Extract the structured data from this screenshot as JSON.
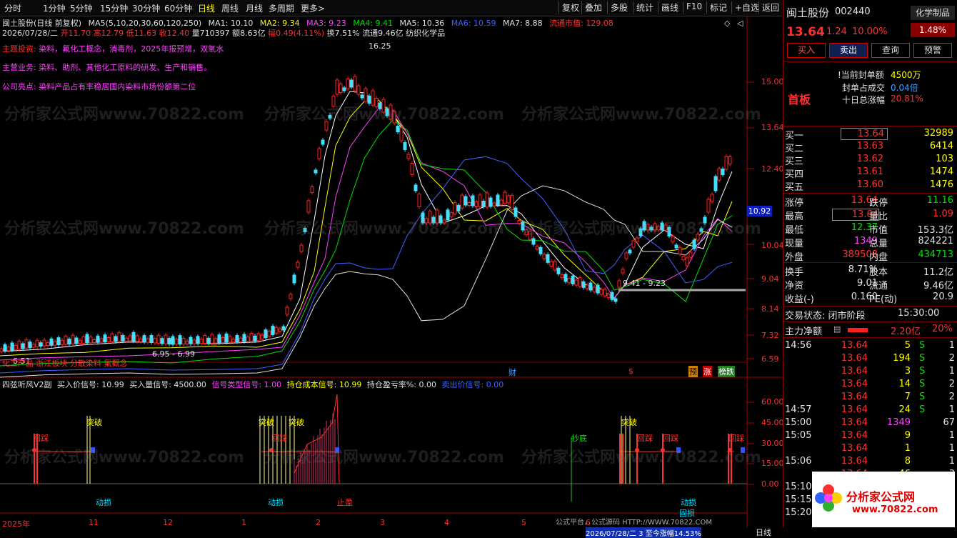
{
  "toolbar": {
    "periods": [
      "分时",
      "1分钟",
      "5分钟",
      "15分钟",
      "30分钟",
      "60分钟",
      "日线",
      "周线",
      "月线",
      "多周期",
      "更多>"
    ],
    "active_period": "日线",
    "buttons": [
      "复权",
      "叠加",
      "多股",
      "统计",
      "画线",
      "F10",
      "标记",
      "+自选",
      "返回"
    ]
  },
  "chart": {
    "title": "闽土股份(日线 前复权)",
    "ma_legend": {
      "params": "MA5(5,10,20,30,60,120,250)",
      "ma1": "MA1: 10.10",
      "ma2": "MA2: 9.34",
      "ma3": "MA3: 9.23",
      "ma4": "MA4: 9.41",
      "ma5": "MA5: 10.36",
      "ma6": "MA6: 10.59",
      "ma7": "MA7: 8.88",
      "float_cap": "流通市值: 129.08"
    },
    "bar_info": {
      "date": "2026/07/28/二",
      "open": "开11.70",
      "high": "高12.79",
      "low": "低11.63",
      "close": "收12.40",
      "volume": "量710397",
      "amount": "额8.63亿",
      "range": "幅0.49(4.11%)",
      "turnover": "换7.51%",
      "float": "流通9.46亿",
      "sector": "纺织化学品"
    },
    "notes": {
      "theme_label": "主题投资:",
      "theme": "染料，氟化工概念，消毒剂，2025年报预增，双氧水",
      "business_label": "主营业务:",
      "business": "染料、助剂、其他化工原料的研发、生产和销售。",
      "highlight_label": "公司亮点:",
      "highlight": "染料产品占有率稳居国内染料市场份额第二位"
    },
    "price_axis": [
      "15.00",
      "13.64",
      "12.40",
      "10.04",
      "9.04",
      "8.14",
      "7.32",
      "6.59"
    ],
    "current_price_tag": "10.92",
    "annotations": {
      "peak": "16.25",
      "low_range": "6.95 - 6.99",
      "mid_range": "9.41 - 9.23",
      "left_low": "6.51",
      "sector_tag": "化工产品 浙江板块 分散染料 氟概念",
      "fin_marker": "财",
      "dollar_marker": "$",
      "tag_yu": "预",
      "tag_zhang": "涨",
      "tag_bang": "榜跌"
    }
  },
  "indicator": {
    "name": "四弦听风V2副",
    "buy_price": "买入价信号: 10.99",
    "buy_qty": "买入量信号: 4500.00",
    "type": "信号类型信号: 1.00",
    "hold_cost": "持仓成本信号: 10.99",
    "hold_pl": "持仓盈亏率%: 0.00",
    "sell_price": "卖出价信号: 0.00",
    "axis": [
      "60.00",
      "45.00",
      "30.00",
      "15.00",
      "0.00"
    ],
    "labels": {
      "tupo": "突破",
      "hui_cai": "回踩",
      "dong_sun": "动损",
      "zhi_ying": "止盈",
      "chao_di": "抄底",
      "gu_sun": "固损"
    },
    "time_axis": [
      "2025年",
      "11",
      "12",
      "1",
      "2",
      "3",
      "4",
      "5",
      "6",
      "2026/07/28/二 3 至今涨幅14.53%",
      "日线"
    ],
    "footer": "公式平台，公式源码 HTTP://WWW.70822.COM"
  },
  "panel": {
    "stock_name": "闽土股份",
    "stock_code": "002440",
    "industry": "化学制品",
    "price": "13.64",
    "change": "1.24",
    "pct": "10.00%",
    "industry_pct": "1.48%",
    "actions": [
      "买入",
      "卖出",
      "查询",
      "预警"
    ],
    "board_label": "首板",
    "seal": [
      {
        "label": "!当前封单额",
        "value": "4500万"
      },
      {
        "label": "封单占成交",
        "value": "0.04倍"
      },
      {
        "label": "十日总涨幅",
        "value": "20.81%"
      }
    ],
    "sells": [
      {
        "label": "买一",
        "price": "13.64",
        "vol": "32989"
      },
      {
        "label": "买二",
        "price": "13.63",
        "vol": "6414"
      },
      {
        "label": "买三",
        "price": "13.62",
        "vol": "103"
      },
      {
        "label": "买四",
        "price": "13.61",
        "vol": "1474"
      },
      {
        "label": "买五",
        "price": "13.60",
        "vol": "1476"
      }
    ],
    "stats": [
      {
        "l1": "涨停",
        "v1": "13.64",
        "l2": "跌停",
        "v2": "11.16"
      },
      {
        "l1": "最高",
        "v1": "13.64",
        "l2": "量比",
        "v2": "1.09"
      },
      {
        "l1": "最低",
        "v1": "12.37",
        "l2": "市值",
        "v2": "153.3亿"
      },
      {
        "l1": "现量",
        "v1": "1349",
        "l2": "总量",
        "v2": "824221"
      },
      {
        "l1": "外盘",
        "v1": "389508",
        "l2": "内盘",
        "v2": "434713"
      }
    ],
    "fin": [
      {
        "l1": "换手",
        "v1": "8.71%",
        "l2": "股本",
        "v2": "11.2亿"
      },
      {
        "l1": "净资",
        "v1": "9.01",
        "l2": "流通",
        "v2": "9.46亿"
      },
      {
        "l1": "收益(-)",
        "v1": "0.160",
        "l2": "PE(动)",
        "v2": "20.9"
      }
    ],
    "trade_status": "交易状态: 闭市阶段",
    "trade_time": "15:30:00",
    "main_flow_label": "主力净额",
    "main_flow": "2.20亿",
    "main_flow_pct": "20%",
    "ticks": [
      {
        "t": "14:56",
        "p": "13.64",
        "v": "5",
        "s": "S",
        "n": "1"
      },
      {
        "t": "",
        "p": "13.64",
        "v": "194",
        "s": "S",
        "n": "2"
      },
      {
        "t": "",
        "p": "13.64",
        "v": "3",
        "s": "S",
        "n": "1"
      },
      {
        "t": "",
        "p": "13.64",
        "v": "14",
        "s": "S",
        "n": "2"
      },
      {
        "t": "",
        "p": "13.64",
        "v": "7",
        "s": "S",
        "n": "2"
      },
      {
        "t": "14:57",
        "p": "13.64",
        "v": "24",
        "s": "S",
        "n": "1"
      },
      {
        "t": "15:00",
        "p": "13.64",
        "v": "1349",
        "s": "",
        "n": "67"
      },
      {
        "t": "15:05",
        "p": "13.64",
        "v": "9",
        "s": "",
        "n": "1"
      },
      {
        "t": "",
        "p": "13.64",
        "v": "1",
        "s": "",
        "n": "1"
      },
      {
        "t": "15:06",
        "p": "13.64",
        "v": "8",
        "s": "",
        "n": "1"
      },
      {
        "t": "",
        "p": "13.64",
        "v": "46",
        "s": "",
        "n": "3"
      },
      {
        "t": "15:10",
        "p": "13.64",
        "v": "",
        "s": "",
        "n": ""
      },
      {
        "t": "15:15",
        "p": "",
        "v": "",
        "s": "",
        "n": ""
      },
      {
        "t": "15:20",
        "p": "",
        "v": "",
        "s": "",
        "n": ""
      }
    ],
    "logo_text": "分析家公式网",
    "logo_url": "www.70822.com"
  },
  "watermark": "分析家公式网www.70822.com"
}
